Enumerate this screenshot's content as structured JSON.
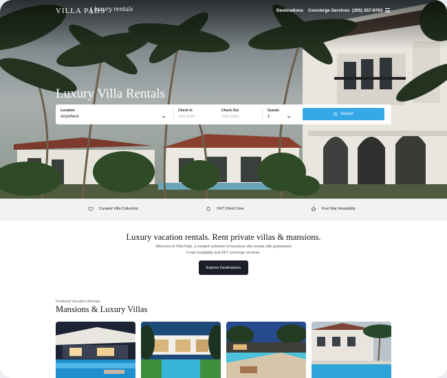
{
  "header": {
    "logo": "VILLA PADS",
    "logo_script": "luxury rentals",
    "nav": [
      "Destinations",
      "Concierge Services",
      "(305) 257-9763"
    ],
    "menu_icon": "hamburger-menu-icon"
  },
  "hero": {
    "title": "Luxury Villa Rentals"
  },
  "search": {
    "location_label": "Location",
    "location_value": "Anywhere",
    "checkin_label": "Check in",
    "checkin_placeholder": "Add Date",
    "checkout_label": "Check Out",
    "checkout_placeholder": "Add Date",
    "guests_label": "Guests",
    "guests_value": "1",
    "button_label": "Search",
    "button_color": "#36a8e8"
  },
  "features": [
    {
      "icon": "heart-icon",
      "label": "Curated Villa Collection"
    },
    {
      "icon": "bell-icon",
      "label": "24/7 Client Care"
    },
    {
      "icon": "star-icon",
      "label": "Five Star Hospitality"
    }
  ],
  "intro": {
    "title": "Luxury vacation rentals. Rent private villas & mansions.",
    "text": "Welcome to Villa Pads, a curated collection of luxurious villa rentals with guaranteed 5-star hospitality and 24/7 concierge services.",
    "button_label": "Explore Destinations"
  },
  "featured": {
    "kicker": "Featured Vacation Rentals",
    "title": "Mansions & Luxury Villas"
  }
}
